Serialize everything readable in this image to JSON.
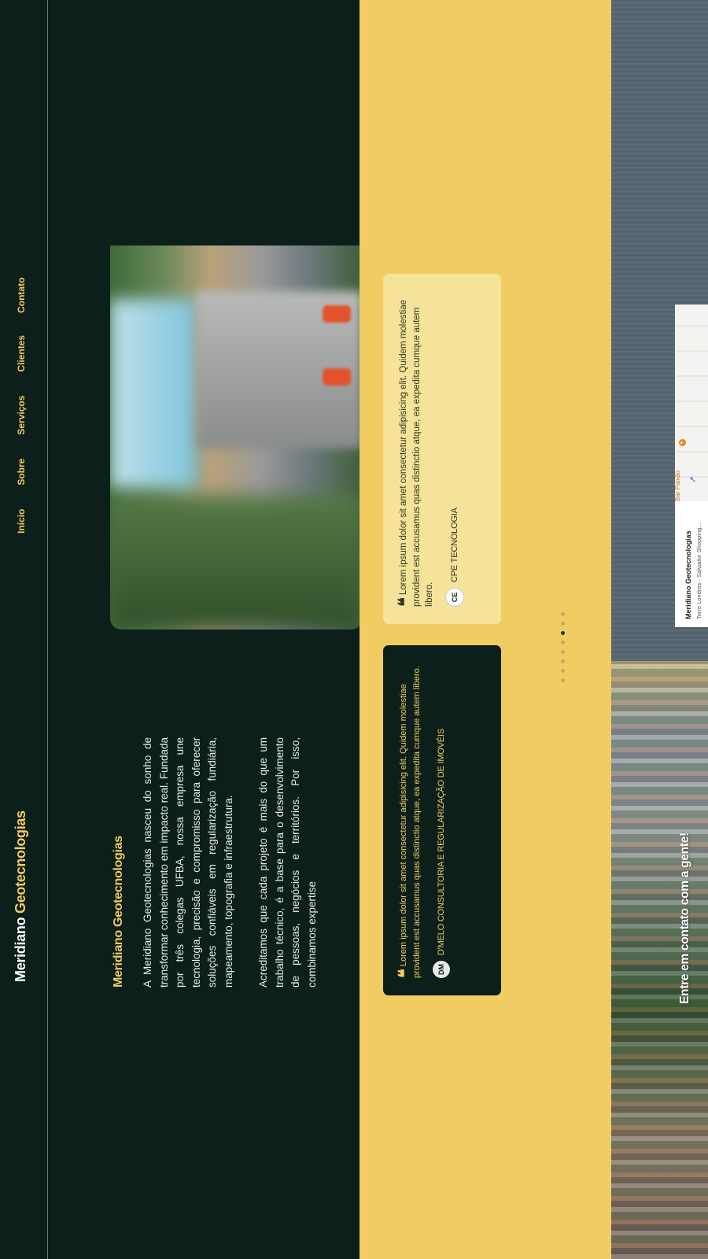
{
  "brand": {
    "part1": "Meridiano",
    "part2": "Geotecnologias"
  },
  "nav": {
    "items": [
      "Início",
      "Sobre",
      "Serviços",
      "Clientes",
      "Contato"
    ]
  },
  "about": {
    "title_part1": "Meridiano",
    "title_part2": "Geotecnologias",
    "paragraphs": [
      "A Meridiano Geotecnologias nasceu do sonho de transformar conhecimento em impacto real. Fundada por três colegas UFBA, nossa empresa une tecnologia, precisão e compromisso para oferecer soluções confiáveis em regularização fundiária, mapeamento, topografia e infraestrutura.",
      "Acreditamos que cada projeto é mais do que um trabalho técnico, é a base para o desenvolvimento de pessoas, negócios e territórios. Por isso, combinamos expertise"
    ]
  },
  "testimonials": [
    {
      "text": "Lorem ipsum dolor sit amet consectetur adipisicing elit. Quidem molestiae provident est accusamus quas distinctio atque, ea expedita cumque autem libero.",
      "author": "D'MELO CONSULTORIA E REGULARIZAÇÃO DE IMOVÉIS",
      "logo": "DM",
      "theme": "dark"
    },
    {
      "text": "Lorem ipsum dolor sit amet consectetur adipisicing elit. Quidem molestiae provident est accusamus quas distinctio atque, ea expedita cumque autem libero.",
      "author": "CPE TECNOLOGIA",
      "logo": "CE",
      "theme": "light"
    }
  ],
  "carousel": {
    "total": 8,
    "active": 5
  },
  "contact": {
    "title": "Entre em contato com a gente!",
    "map_title": "Meridiano Geotecnologias",
    "map_address": "Torre Londres - Salvador Shopping...",
    "map_place": "Bar Paixão"
  },
  "colors": {
    "dark": "#0d1f1a",
    "accent": "#f2cd5f",
    "band": "#f1cc62"
  },
  "icons": {
    "quote": "quote-icon",
    "directions": "directions-icon",
    "pin": "map-pin-icon"
  }
}
